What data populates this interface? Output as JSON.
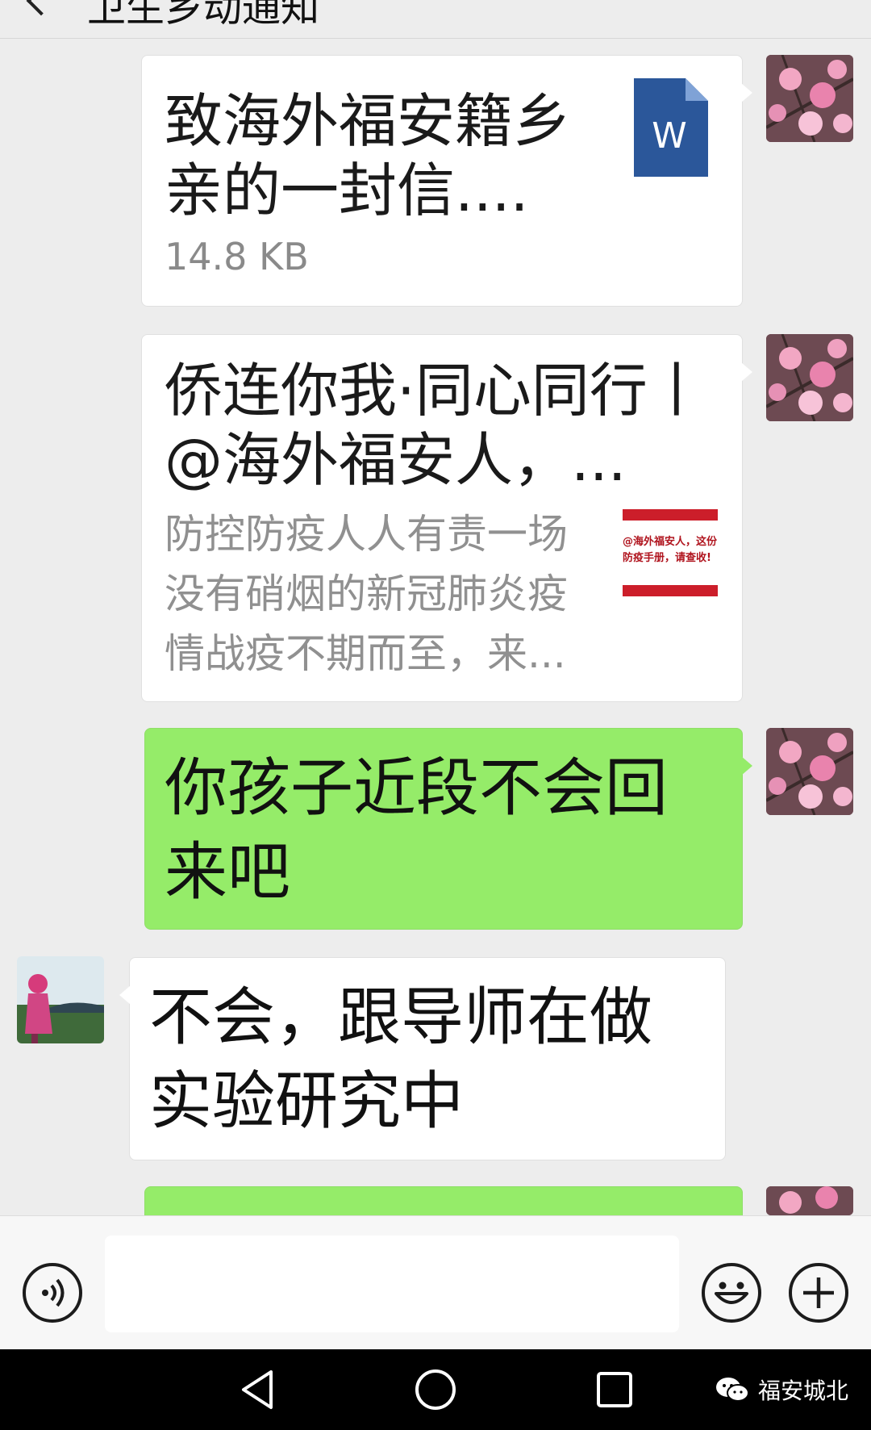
{
  "header": {
    "title": "卫生乡动通知"
  },
  "messages": [
    {
      "type": "file",
      "file_name": "致海外福安籍乡亲的一封信....",
      "file_size": "14.8 KB",
      "icon": "word-doc-icon",
      "icon_letter": "W"
    },
    {
      "type": "link",
      "title": "侨连你我·同心同行丨@海外福安人，...",
      "description": "防控防疫人人有责一场没有硝烟的新冠肺炎疫情战疫不期而至，来...",
      "thumb_text": "@海外福安人，这份防疫手册，请查收!"
    },
    {
      "type": "text",
      "sender": "self",
      "text": "你孩子近段不会回来吧"
    },
    {
      "type": "text",
      "sender": "other",
      "text": "不会，跟导师在做实验研究中"
    }
  ],
  "input": {
    "value": "",
    "placeholder": ""
  },
  "watermark": {
    "text": "福安城北",
    "icon": "wechat-official-account-icon"
  },
  "colors": {
    "background": "#ededed",
    "self_bubble": "#95ec69",
    "other_bubble": "#ffffff",
    "word_icon": "#2b579a"
  }
}
